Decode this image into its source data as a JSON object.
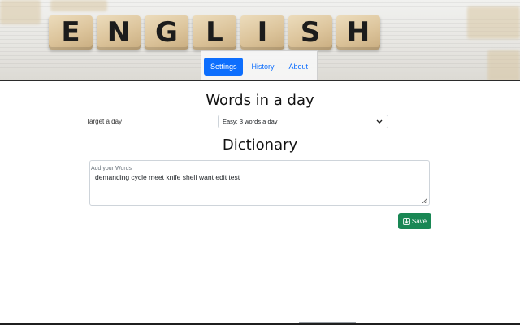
{
  "banner": {
    "letters": [
      "E",
      "N",
      "G",
      "L",
      "I",
      "S",
      "H"
    ]
  },
  "nav": {
    "items": [
      {
        "label": "Settings",
        "active": true
      },
      {
        "label": "History",
        "active": false
      },
      {
        "label": "About",
        "active": false
      }
    ]
  },
  "words_section": {
    "heading": "Words in a day",
    "target_label": "Target a day",
    "selected_option": "Easy: 3 words a day"
  },
  "dictionary_section": {
    "heading": "Dictionary",
    "placeholder": "Add your Words",
    "value": "demanding cycle meet knife shelf want edit test"
  },
  "actions": {
    "save_label": "Save",
    "save_color": "#198754"
  },
  "colors": {
    "accent": "#0d6efd"
  },
  "icons": {
    "select_chevron": "chevron-down-icon",
    "save_icon": "download-icon"
  }
}
